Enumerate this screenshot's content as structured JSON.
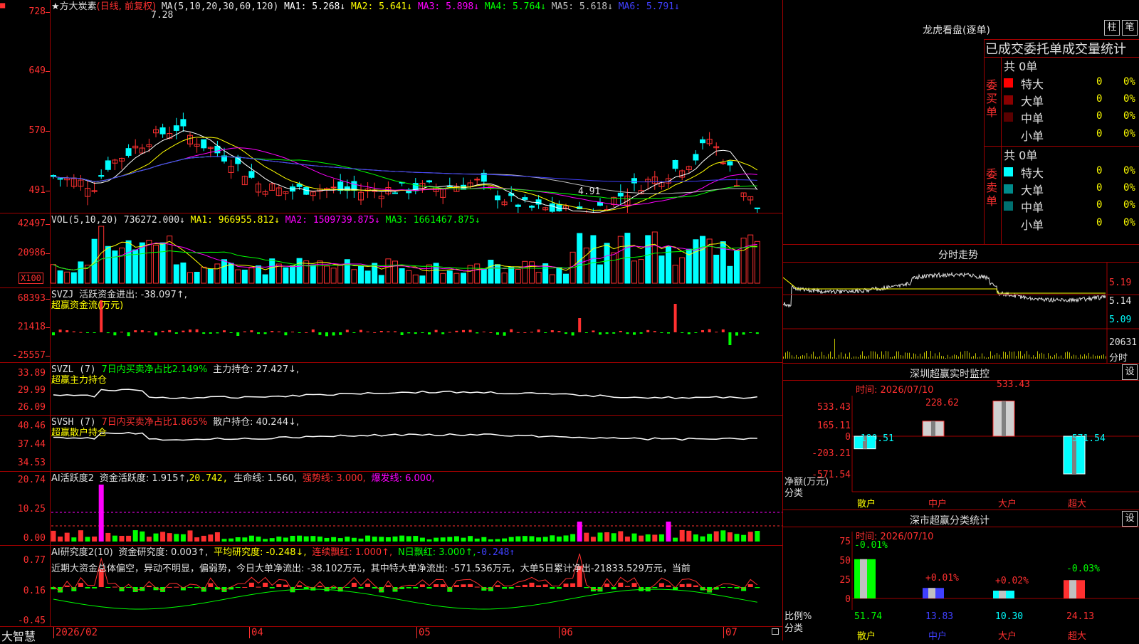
{
  "stock": {
    "name": "★方大炭素",
    "period": "(日线, 前复权)",
    "status_icon": "■"
  },
  "ma_header": {
    "label": "MA(5,10,20,30,60,120)",
    "ma1": "MA1: 5.268↓",
    "ma2": "MA2: 5.641↓",
    "ma3": "MA3: 5.898↓",
    "ma4": "MA4: 5.764↓",
    "ma5": "MA5: 5.618↓",
    "ma6": "MA6: 5.791↓"
  },
  "price_axis": [
    "728",
    "649",
    "570",
    "491"
  ],
  "high_mark": "7.28",
  "low_mark": "4.91",
  "vol_header": {
    "label": "VOL(5,10,20)",
    "v": "736272.000↓",
    "ma1": "MA1: 966955.812↓",
    "ma2": "MA2: 1509739.875↓",
    "ma3": "MA3: 1661467.875↓"
  },
  "vol_axis": [
    "42497",
    "20986"
  ],
  "vol_unit": "X100",
  "svzj": {
    "label": "SVZJ",
    "text": "活跃资金进出: -38.097↑,",
    "sub": "超赢资金流(万元)",
    "axis": [
      "68393",
      "21418",
      "-25557"
    ]
  },
  "svzl": {
    "label": "SVZL (7)",
    "text1": "7日内买卖净占比2.149%",
    "text2": "主力持仓: 27.427↓,",
    "sub": "超赢主力持仓",
    "axis": [
      "33.89",
      "29.99",
      "26.09"
    ]
  },
  "svsh": {
    "label": "SVSH (7)",
    "text1": "7日内买卖净占比1.865%",
    "text2": "散户持仓: 40.244↓,",
    "sub": "超赢散户持仓",
    "axis": [
      "40.46",
      "37.44",
      "34.53"
    ]
  },
  "ai1": {
    "label": "AI活跃度2",
    "t1": "资金活跃度: 1.915↑,",
    "t2": "20.742,",
    "t3": "生命线: 1.560,",
    "t4": "强势线: 3.000,",
    "t5": "爆发线: 6.000,",
    "axis": [
      "20.74",
      "10.25",
      "0.00"
    ]
  },
  "ai2": {
    "label": "AI研究度2(10)",
    "t1": "资金研究度: 0.003↑,",
    "t2": "平均研究度: -0.248↓,",
    "t3": "连续飘红: 1.000↑,",
    "t4": "N日飘红: 3.000↑,",
    "t5": "-0.248↑",
    "comment": "近期大资金总体偏空，异动不明显，偏弱势，今日大单净流出: -38.102万元，其中特大单净流出: -571.536万元，大单5日累计净出-21833.529万元，当前",
    "axis": [
      "0.77",
      "0.16",
      "-0.45"
    ]
  },
  "date_axis": {
    "brand": "大智慧",
    "labels": [
      "2026/02",
      "04",
      "05",
      "06",
      "07"
    ]
  },
  "dragon": {
    "title": "龙虎看盘(逐单)",
    "btn1": "柱",
    "btn2": "笔",
    "subtitle": "已成交委托单成交量统计",
    "buy_side": "委买单",
    "sell_side": "委卖单",
    "buy_total": "共 0单",
    "sell_total": "共 0单",
    "buy_rows": [
      {
        "name": "特大",
        "n": "0",
        "p": "0%"
      },
      {
        "name": "大单",
        "n": "0",
        "p": "0%"
      },
      {
        "name": "中单",
        "n": "0",
        "p": "0%"
      },
      {
        "name": "小单",
        "n": "0",
        "p": "0%"
      }
    ],
    "sell_rows": [
      {
        "name": "特大",
        "n": "0",
        "p": "0%"
      },
      {
        "name": "大单",
        "n": "0",
        "p": "0%"
      },
      {
        "name": "中单",
        "n": "0",
        "p": "0%"
      },
      {
        "name": "小单",
        "n": "0",
        "p": "0%"
      }
    ]
  },
  "intraday": {
    "title": "分时走势",
    "axis": [
      "5.19",
      "5.14",
      "5.09"
    ],
    "vol": "20631",
    "vol_label": "分时"
  },
  "monitor": {
    "title": "深圳超赢实时监控",
    "btn": "设",
    "time": "时间: 2026/07/10",
    "ylabel": "净额(万元)",
    "xlabel": "分类",
    "axis": [
      "533.43",
      "165.11",
      "0",
      "-203.21",
      "-571.54"
    ],
    "bars": [
      {
        "cat": "散户",
        "v": "-190.51"
      },
      {
        "cat": "中户",
        "v": "228.62"
      },
      {
        "cat": "大户",
        "v": "533.43"
      },
      {
        "cat": "超大",
        "v": "-571.54"
      }
    ]
  },
  "stats": {
    "title": "深市超赢分类统计",
    "btn": "设",
    "time": "时间: 2026/07/10",
    "ylabel": "比例%",
    "xlabel": "分类",
    "axis": [
      "75",
      "50",
      "25",
      "0"
    ],
    "bars": [
      {
        "cat": "散户",
        "v": "51.74",
        "d": "-0.01%"
      },
      {
        "cat": "中户",
        "v": "13.83",
        "d": "+0.01%"
      },
      {
        "cat": "大户",
        "v": "10.30",
        "d": "+0.02%"
      },
      {
        "cat": "超大",
        "v": "24.13",
        "d": "-0.03%"
      }
    ]
  },
  "colors": {
    "up": "#ff3030",
    "down": "#00ffff",
    "grid": "#a00000",
    "ma1": "#ffffff",
    "ma2": "#ffff00",
    "ma3": "#ff00ff",
    "ma4": "#00ff00",
    "ma5": "#c0c0c0",
    "ma6": "#4040ff"
  }
}
